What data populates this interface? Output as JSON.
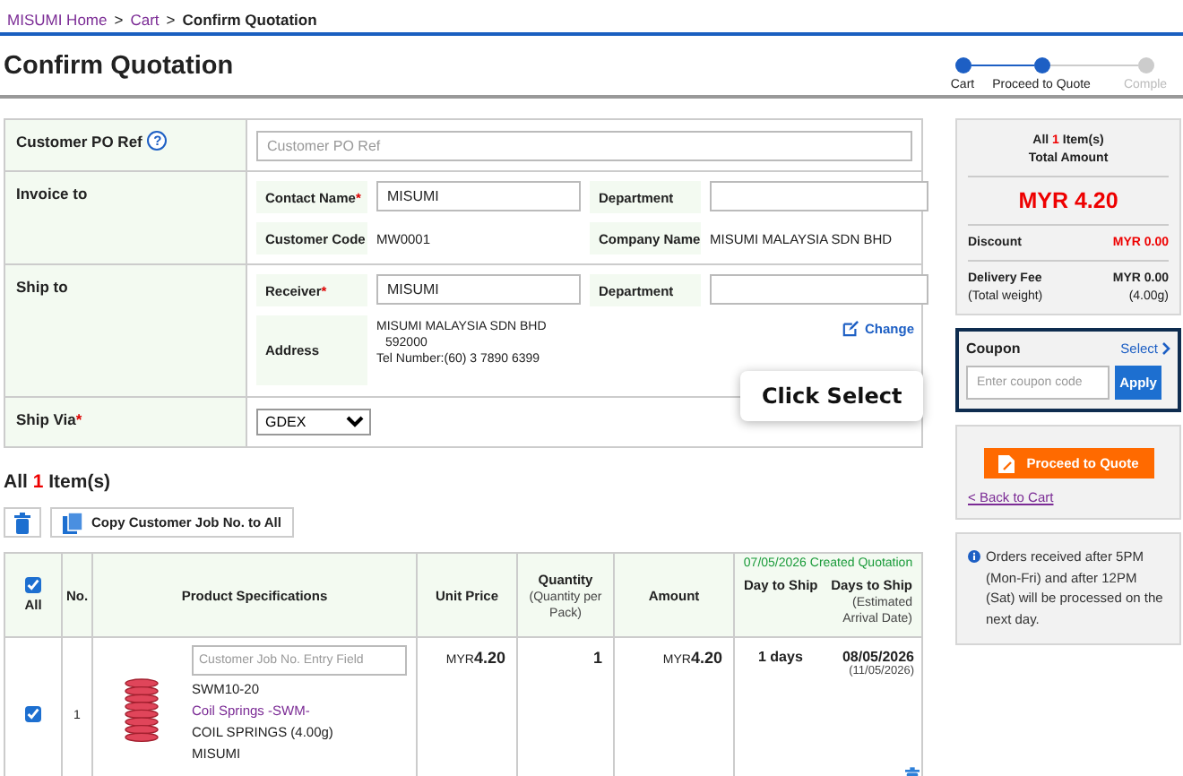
{
  "breadcrumb": [
    {
      "label": "MISUMI Home",
      "link": true
    },
    {
      "separator": ">",
      "label": "Cart",
      "link": true
    },
    {
      "separator": ">",
      "label": "Confirm Quotation",
      "link": false
    }
  ],
  "title": "Confirm Quotation",
  "steps": [
    {
      "label": "Cart",
      "done": true
    },
    {
      "label": "Proceed to Quote",
      "done": true
    },
    {
      "label": "Comple",
      "done": false
    }
  ],
  "form": {
    "po_ref": {
      "label": "Customer PO Ref",
      "help": "?",
      "placeholder": "Customer PO Ref"
    },
    "invoice_to": {
      "label": "Invoice to",
      "contact": {
        "label": "Contact Name",
        "required_mark": "*",
        "value": "MISUMI"
      },
      "department": {
        "label": "Department"
      },
      "customer_code": {
        "label": "Customer Code",
        "value": "MW0001"
      },
      "company": {
        "label": "Company Name",
        "value": "MISUMI MALAYSIA SDN BHD"
      }
    },
    "ship_to": {
      "label": "Ship to",
      "receiver": {
        "label": "Receiver",
        "required_mark": "*",
        "value": "MISUMI"
      },
      "department": {
        "label": "Department"
      },
      "address": {
        "label": "Address",
        "lines": [
          "MISUMI MALAYSIA SDN BHD",
          "592000",
          "Tel Number:(60) 3 7890 6399"
        ]
      },
      "change": "Change"
    },
    "ship_via": {
      "label": "Ship Via",
      "required_mark": "*",
      "value": "GDEX"
    }
  },
  "tooltip": {
    "text": "Click Select"
  },
  "items": {
    "prefix": "All",
    "count": "1",
    "suffix": "Item(s)",
    "copy_button": "Copy Customer Job No. to All",
    "columns": [
      {
        "label": "All",
        "kind": "checkbox",
        "checked": true
      },
      {
        "label": "No.",
        "kind": "text"
      },
      {
        "label": "Product Specifications",
        "kind": "text"
      },
      {
        "label": "Unit Price",
        "kind": "text"
      },
      {
        "label": "Quantity",
        "sub": "(Quantity per Pack)",
        "kind": "text"
      },
      {
        "label": "Amount",
        "kind": "text"
      }
    ],
    "ship_header": {
      "created": "07/05/2026 Created Quotation",
      "day_to_ship": "Day to Ship",
      "days_to_ship": "Days to Ship",
      "days_sub": "(Estimated Arrival Date)"
    },
    "rows": [
      {
        "checked": true,
        "no": "1",
        "job_placeholder": "Customer Job No. Entry Field",
        "part_number": "SWM10-20",
        "series": "Coil Springs -SWM-",
        "description": "COIL SPRINGS (4.00g)",
        "brand": "MISUMI",
        "unit_currency": "MYR",
        "unit_price": "4.20",
        "quantity": "1",
        "amount_currency": "MYR",
        "amount": "4.20",
        "day_to_ship": "1 days",
        "ship_date": "08/05/2026",
        "arrival_date": "(11/05/2026)"
      }
    ]
  },
  "summary": {
    "count_prefix": "All",
    "count": "1",
    "count_suffix": "Item(s)",
    "total_label": "Total Amount",
    "total": "MYR 4.20",
    "discount_label": "Discount",
    "discount": "MYR 0.00",
    "delivery_label": "Delivery Fee",
    "delivery": "MYR 0.00",
    "weight_label": "(Total weight)",
    "weight": "(4.00g)"
  },
  "coupon": {
    "label": "Coupon",
    "select": "Select",
    "placeholder": "Enter coupon code",
    "apply": "Apply",
    "highlighted": true
  },
  "actions": {
    "proceed": "Proceed to Quote",
    "back": "< Back to Cart"
  },
  "notice": "Orders received after 5PM (Mon-Fri) and after 12PM (Sat) will be processed on the next day."
}
